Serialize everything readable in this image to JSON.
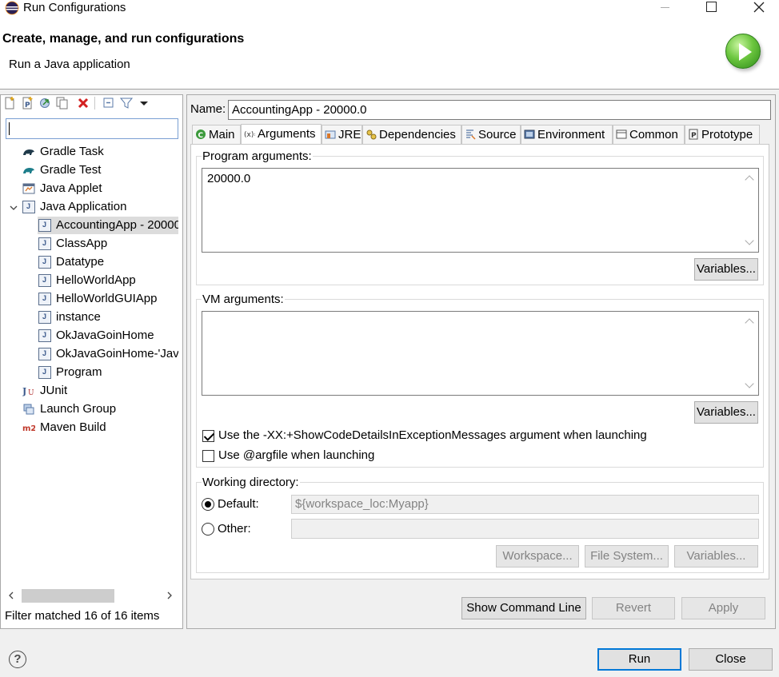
{
  "window": {
    "title": "Run Configurations"
  },
  "header": {
    "title": "Create, manage, and run configurations",
    "subtitle": "Run a Java application"
  },
  "left_toolbar": {
    "icons": [
      "new-configuration-icon",
      "new-prototype-icon",
      "export-icon",
      "duplicate-icon",
      "delete-icon",
      "collapse-all-icon",
      "filter-icon",
      "view-menu-icon"
    ]
  },
  "filter": {
    "value": "",
    "status": "Filter matched 16 of 16 items"
  },
  "tree": {
    "items": [
      {
        "label": "Gradle Task",
        "icon": "gradle-icon"
      },
      {
        "label": "Gradle Test",
        "icon": "gradle-test-icon"
      },
      {
        "label": "Java Applet",
        "icon": "java-applet-icon"
      },
      {
        "label": "Java Application",
        "icon": "java-application-icon",
        "expanded": true
      },
      {
        "label": "AccountingApp - 20000",
        "icon": "java-file-icon",
        "selected": true
      },
      {
        "label": "ClassApp",
        "icon": "java-file-icon"
      },
      {
        "label": "Datatype",
        "icon": "java-file-icon"
      },
      {
        "label": "HelloWorldApp",
        "icon": "java-file-icon"
      },
      {
        "label": "HelloWorldGUIApp",
        "icon": "java-file-icon"
      },
      {
        "label": "instance",
        "icon": "java-file-icon"
      },
      {
        "label": "OkJavaGoinHome",
        "icon": "java-file-icon"
      },
      {
        "label": "OkJavaGoinHome-'Java",
        "icon": "java-file-icon"
      },
      {
        "label": "Program",
        "icon": "java-file-icon"
      },
      {
        "label": "JUnit",
        "icon": "junit-icon"
      },
      {
        "label": "Launch Group",
        "icon": "launch-group-icon"
      },
      {
        "label": "Maven Build",
        "icon": "maven-icon"
      }
    ]
  },
  "config": {
    "name_label": "Name:",
    "name_value": "AccountingApp - 20000.0",
    "tabs": [
      {
        "label": "Main",
        "icon": "main-tab-icon"
      },
      {
        "label": "Arguments",
        "icon": "arguments-tab-icon",
        "active": true
      },
      {
        "label": "JRE",
        "icon": "jre-tab-icon"
      },
      {
        "label": "Dependencies",
        "icon": "dependencies-tab-icon"
      },
      {
        "label": "Source",
        "icon": "source-tab-icon"
      },
      {
        "label": "Environment",
        "icon": "environment-tab-icon"
      },
      {
        "label": "Common",
        "icon": "common-tab-icon"
      },
      {
        "label": "Prototype",
        "icon": "prototype-tab-icon"
      }
    ],
    "program_args": {
      "label": "Program arguments:",
      "value": "20000.0",
      "variables_label": "Variables..."
    },
    "vm_args": {
      "label": "VM arguments:",
      "value": "",
      "variables_label": "Variables..."
    },
    "options": {
      "show_code_details": {
        "label": "Use the -XX:+ShowCodeDetailsInExceptionMessages argument when launching",
        "checked": true
      },
      "argfile": {
        "label": "Use @argfile when launching",
        "checked": false
      }
    },
    "working_directory": {
      "label": "Working directory:",
      "default_label": "Default:",
      "default_value": "${workspace_loc:Myapp}",
      "other_label": "Other:",
      "other_value": "",
      "selected": "default",
      "workspace_label": "Workspace...",
      "filesystem_label": "File System...",
      "variables_label": "Variables..."
    },
    "buttons": {
      "show_command_line": "Show Command Line",
      "revert": "Revert",
      "apply": "Apply"
    }
  },
  "footer": {
    "help": "?",
    "run": "Run",
    "close": "Close"
  },
  "colors": {
    "accent": "#0078d7",
    "window_bg": "#f0f0f0"
  }
}
